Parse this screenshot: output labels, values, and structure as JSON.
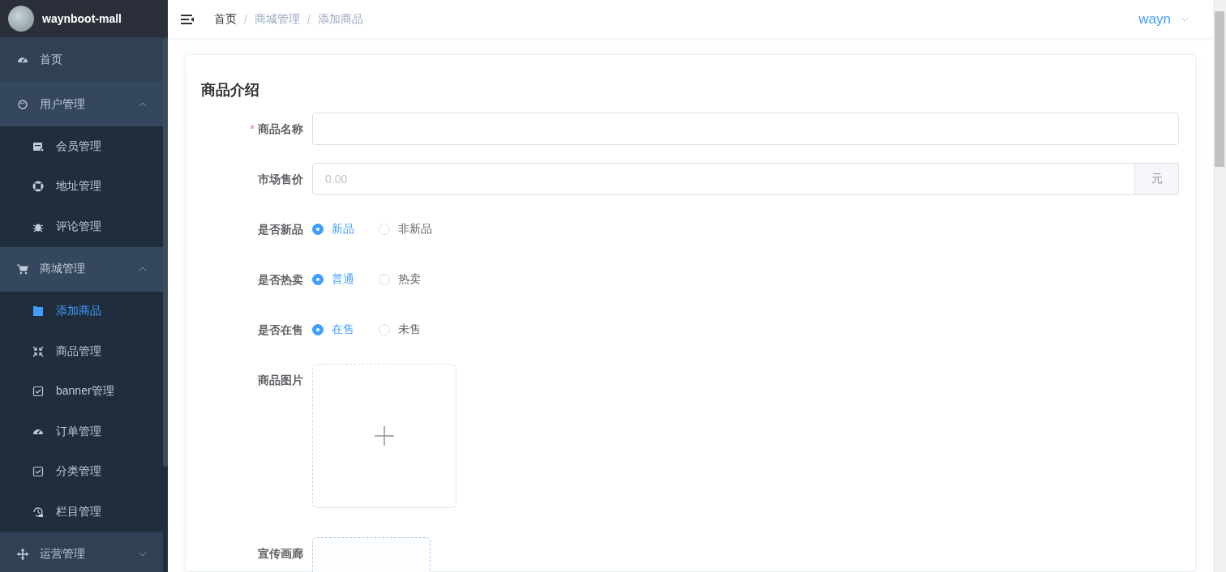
{
  "sidebar": {
    "logo": {
      "title": "waynboot-mall"
    },
    "items": [
      {
        "label": "首页",
        "selected": false
      },
      {
        "label": "用户管理",
        "expanded": true,
        "children": [
          {
            "label": "会员管理",
            "selected": false
          },
          {
            "label": "地址管理",
            "selected": false
          },
          {
            "label": "评论管理",
            "selected": false
          }
        ]
      },
      {
        "label": "商城管理",
        "expanded": true,
        "children": [
          {
            "label": "添加商品",
            "selected": true
          },
          {
            "label": "商品管理",
            "selected": false
          },
          {
            "label": "banner管理",
            "selected": false
          },
          {
            "label": "订单管理",
            "selected": false
          },
          {
            "label": "分类管理",
            "selected": false
          },
          {
            "label": "栏目管理",
            "selected": false
          }
        ]
      },
      {
        "label": "运营管理",
        "expanded": false
      }
    ]
  },
  "header": {
    "breadcrumb": {
      "separator": "/",
      "items": [
        {
          "label": "首页",
          "link": true
        },
        {
          "label": "商城管理",
          "link": false
        },
        {
          "label": "添加商品",
          "link": false
        }
      ]
    },
    "user": "wayn"
  },
  "form": {
    "title": "商品介绍",
    "fields": [
      {
        "kind": "input",
        "label": "商品名称",
        "required_mark": "*"
      },
      {
        "kind": "input",
        "label": "市场售价",
        "placeholder": "0.00",
        "suffix": "元"
      },
      {
        "kind": "radio",
        "label": "是否新品",
        "options": [
          {
            "label": "新品",
            "selected": true
          },
          {
            "label": "非新品",
            "selected": false
          }
        ]
      },
      {
        "kind": "radio",
        "label": "是否热卖",
        "options": [
          {
            "label": "普通",
            "selected": true
          },
          {
            "label": "热卖",
            "selected": false
          }
        ]
      },
      {
        "kind": "radio",
        "label": "是否在售",
        "options": [
          {
            "label": "在售",
            "selected": true
          },
          {
            "label": "未售",
            "selected": false
          }
        ]
      },
      {
        "kind": "upload",
        "label": "商品图片"
      },
      {
        "kind": "gallery",
        "label": "宣传画廊"
      }
    ]
  }
}
